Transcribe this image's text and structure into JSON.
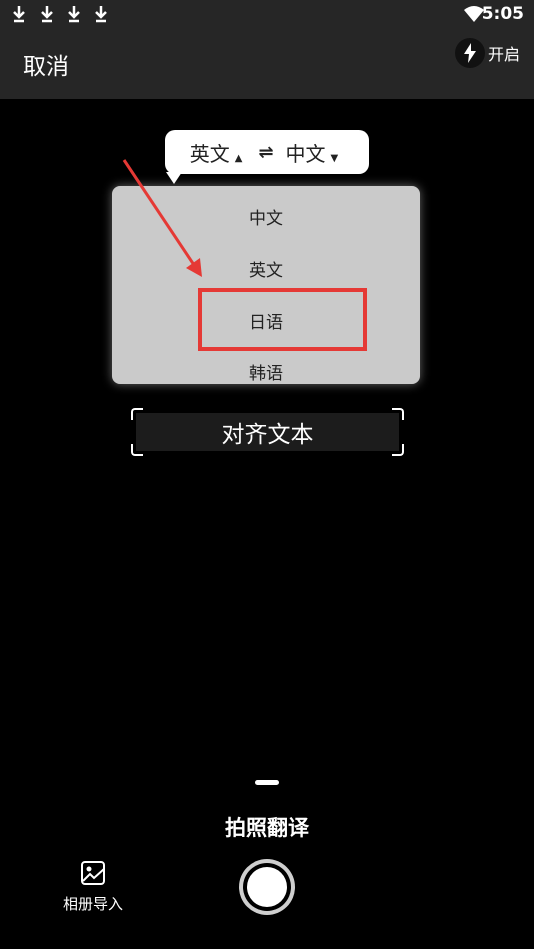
{
  "status_bar": {
    "time": "5:05",
    "icons": [
      "download-icon",
      "download-icon",
      "download-icon",
      "download-icon",
      "wifi-icon",
      "battery-icon"
    ]
  },
  "header": {
    "cancel_label": "取消",
    "flash_label": "开启"
  },
  "language_selector": {
    "source": "英文",
    "target": "中文",
    "swap_icon": "swap-icon"
  },
  "dropdown": {
    "items": [
      "中文",
      "英文",
      "日语",
      "韩语"
    ],
    "highlighted": "日语"
  },
  "scan": {
    "hint": "对齐文本"
  },
  "bottom": {
    "mode_label": "拍照翻译",
    "album_label": "相册导入"
  },
  "colors": {
    "header_bg": "#262626",
    "annotation": "#e53935",
    "dropdown_bg": "#cacaca"
  }
}
